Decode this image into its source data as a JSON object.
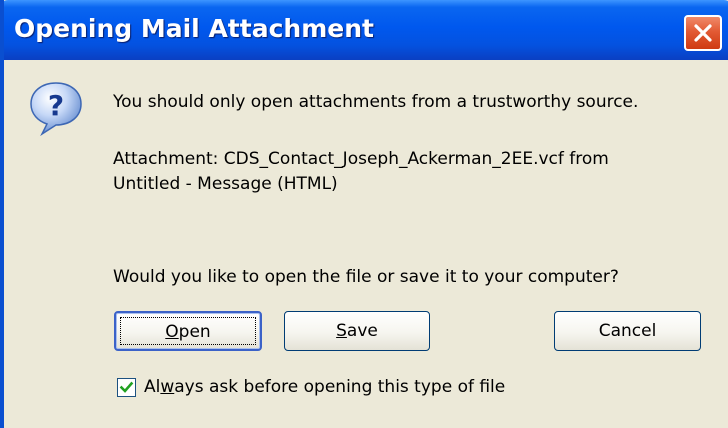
{
  "window": {
    "title": "Opening Mail Attachment"
  },
  "icons": {
    "dialog_icon": "question-icon",
    "close_icon": "close-icon",
    "check_icon": "check-icon"
  },
  "message": {
    "warning": "You should only open attachments from a trustworthy source.",
    "attachment_line1": "Attachment: CDS_Contact_Joseph_Ackerman_2EE.vcf from",
    "attachment_line2": "Untitled - Message (HTML)",
    "question": "Would you like to open the file or save it to your computer?"
  },
  "buttons": {
    "open": {
      "label_hotkey": "O",
      "label_rest": "pen"
    },
    "save": {
      "label_hotkey": "S",
      "label_rest": "ave"
    },
    "cancel": {
      "label": "Cancel"
    }
  },
  "checkbox": {
    "checked": true,
    "label_before": "Al",
    "label_hotkey": "w",
    "label_after": "ays ask before opening this type of file"
  },
  "colors": {
    "titlebar": "#0058ee",
    "dialog_background": "#ece9d8",
    "close_button": "#e25a34",
    "checkmark": "#21a121"
  }
}
